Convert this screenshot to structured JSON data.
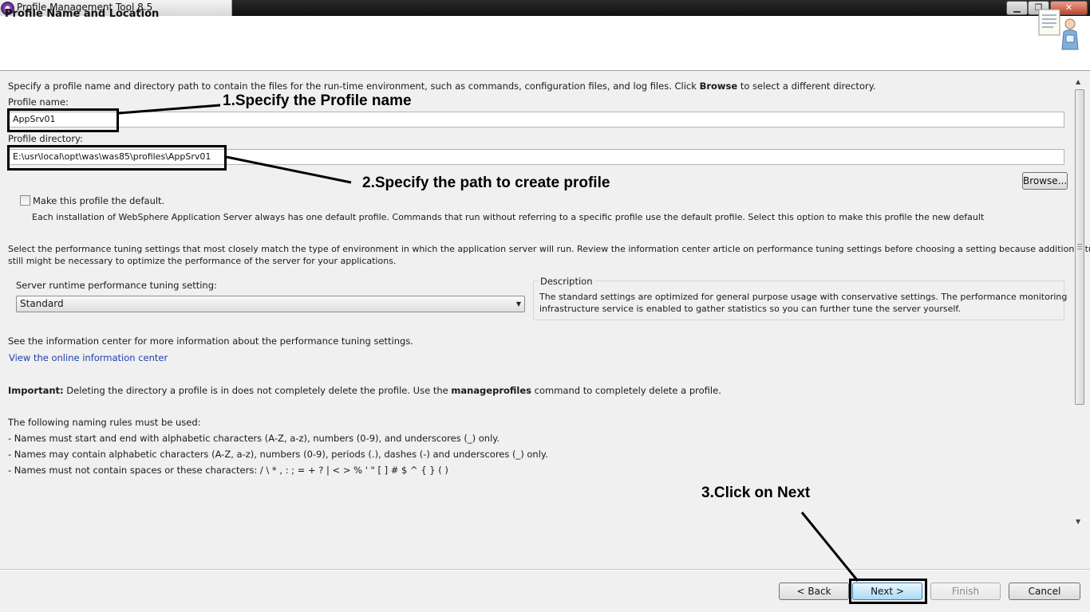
{
  "window": {
    "title": "Profile Management Tool 8.5",
    "minimize_glyph": "▁",
    "maximize_glyph": "❐",
    "close_glyph": "✕"
  },
  "header": {
    "title": "Profile Name and Location",
    "icon": "wizard-document-person-icon"
  },
  "intro": {
    "text_before": "Specify a profile name and directory path to contain the files for the run-time environment, such as commands, configuration files, and log files. Click ",
    "bold": "Browse",
    "text_after": " to select a different directory."
  },
  "profile_name": {
    "label": "Profile name:",
    "value": "AppSrv01"
  },
  "profile_directory": {
    "label": "Profile directory:",
    "value": "E:\\usr\\local\\opt\\was\\was85\\profiles\\AppSrv01",
    "browse_label": "Browse..."
  },
  "default_profile": {
    "checkbox_label": "Make this profile the default.",
    "checked": false,
    "description": "Each installation of WebSphere Application Server always has one default profile. Commands that run without referring to a specific profile use the default profile. Select this option to make this profile the new default"
  },
  "tuning": {
    "intro_line1": "Select the performance tuning settings that most closely match the type of environment in which the application server will run. Review the information center article on performance tuning settings before choosing a setting because additional tuning",
    "intro_line2": "still might be necessary to optimize the performance of the server for your applications.",
    "select_label": "Server runtime performance tuning setting:",
    "select_value": "Standard",
    "description_title": "Description",
    "description_line1": "The standard settings are optimized for general purpose usage with conservative settings. The performance monitoring",
    "description_line2": "infrastructure service is enabled to gather statistics so you can further tune the server yourself."
  },
  "info_center": {
    "text": "See the information center for more information about the performance tuning settings.",
    "link": "View the online information center"
  },
  "important": {
    "label": "Important:",
    "text_before": " Deleting the directory a profile is in does not completely delete the profile. Use the ",
    "command": "manageprofiles",
    "text_after": " command to completely delete a profile."
  },
  "naming_rules": {
    "title": "The following naming rules must be used:",
    "rules": [
      "- Names must start and end with alphabetic characters (A-Z, a-z), numbers (0-9), and underscores (_) only.",
      "- Names may contain alphabetic characters (A-Z, a-z), numbers (0-9), periods (.), dashes (-) and underscores (_) only.",
      "- Names must not contain spaces or these characters: / \\ * , : ; = + ? | < >  % ' \" [ ] # $ ^ { } ( )"
    ]
  },
  "buttons": {
    "back": "< Back",
    "next": "Next >",
    "finish": "Finish",
    "cancel": "Cancel"
  },
  "annotations": {
    "step1": "1.Specify the Profile name",
    "step2": "2.Specify the path to create profile",
    "step3": "3.Click on Next"
  },
  "colors": {
    "link": "#1c3fa8",
    "background": "#f0f0f0",
    "annotation": "#000000"
  }
}
